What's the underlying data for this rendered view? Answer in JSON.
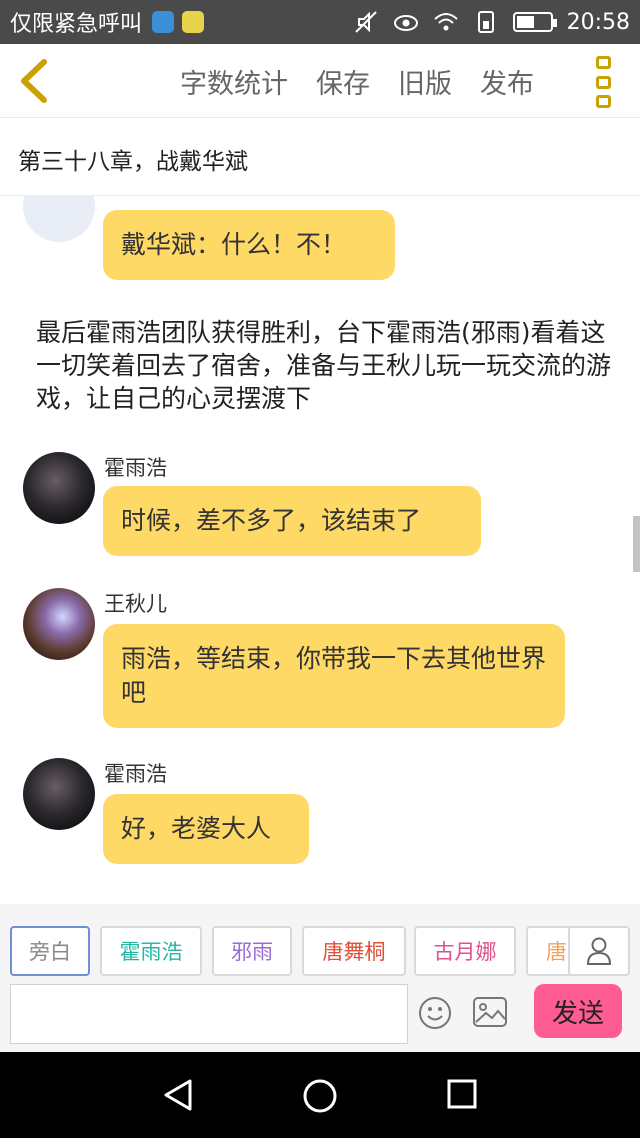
{
  "status_bar": {
    "carrier": "仅限紧急呼叫",
    "time": "20:58",
    "battery_level": 0.55
  },
  "toolbar": {
    "back_icon": "chevron-left-icon",
    "actions": [
      "字数统计",
      "保存",
      "旧版",
      "发布"
    ],
    "more_icon": "vertical-more-icon",
    "accent": "#c9a100"
  },
  "chapter": {
    "title": "第三十八章，战戴华斌"
  },
  "messages": [
    {
      "sender": "",
      "text": "戴华斌：什么！不！"
    },
    {
      "narration": "最后霍雨浩团队获得胜利，台下霍雨浩(邪雨)看着这一切笑着回去了宿舍，准备与王秋儿玩一玩交流的游戏，让自己的心灵摆渡下"
    },
    {
      "sender": "霍雨浩",
      "text": "时候，差不多了，该结束了"
    },
    {
      "sender": "王秋儿",
      "text": "雨浩，等结束，你带我一下去其他世界吧"
    },
    {
      "sender": "霍雨浩",
      "text": "好，老婆大人"
    }
  ],
  "roles": [
    {
      "label": "旁白",
      "color": "#888888"
    },
    {
      "label": "霍雨浩",
      "color": "#26b6a4"
    },
    {
      "label": "邪雨",
      "color": "#9b6ad6"
    },
    {
      "label": "唐舞桐",
      "color": "#e0503a"
    },
    {
      "label": "古月娜",
      "color": "#e0508a"
    },
    {
      "label": "唐",
      "color": "#f2a15a"
    }
  ],
  "input": {
    "placeholder": "",
    "send_label": "发送",
    "send_color": "#ff5c93"
  },
  "bubble_color": "#ffd966"
}
